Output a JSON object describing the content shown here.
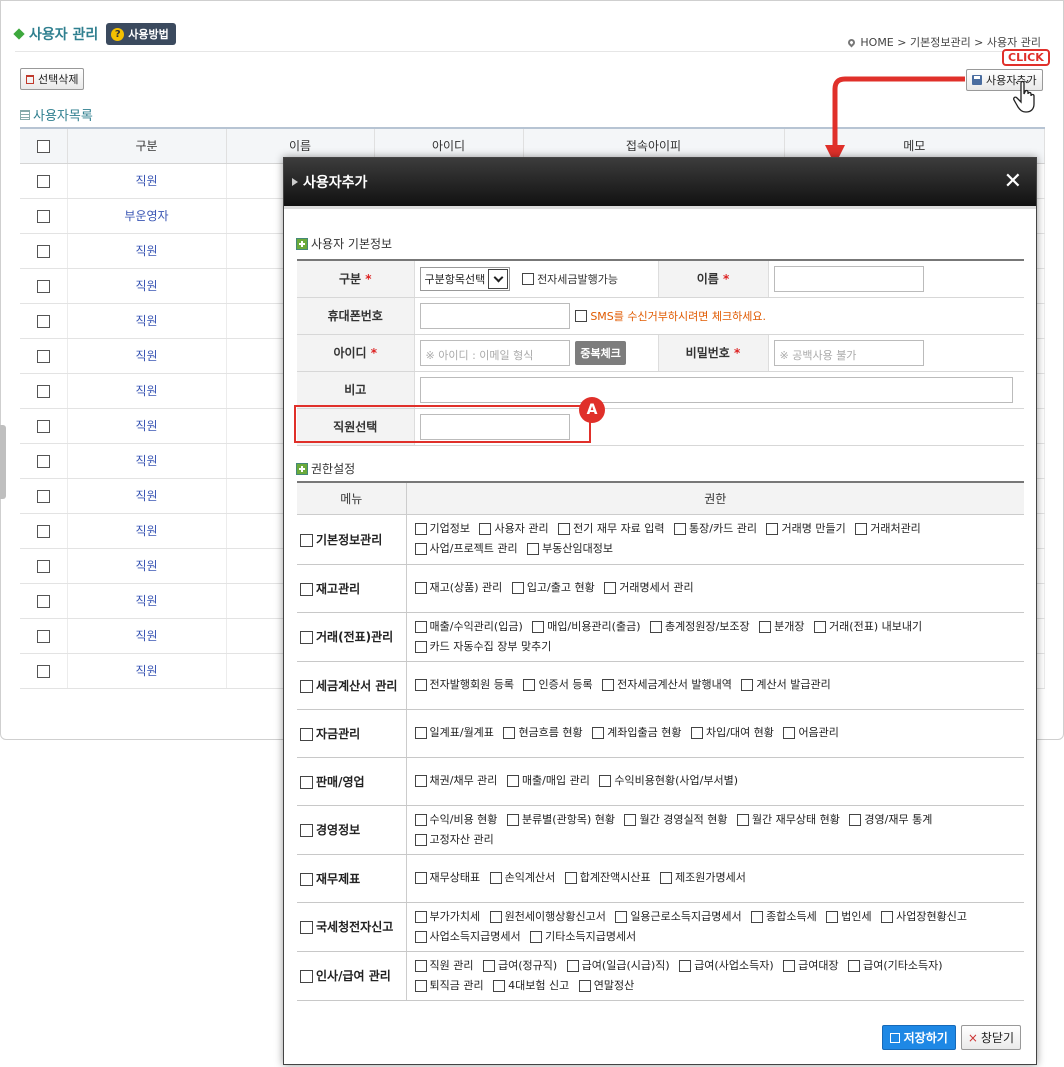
{
  "page": {
    "title": "사용자 관리",
    "help_label": "사용방법",
    "help_icon": "question-icon",
    "breadcrumb": "HOME > 기본정보관리 > 사용자 관리",
    "delete_label": "선택삭제",
    "add_label": "사용자추가",
    "click_label": "CLICK",
    "list_title": "사용자목록",
    "accent_color": "#e0302a"
  },
  "list": {
    "columns": [
      "구분",
      "이름",
      "아이디",
      "접속아이피",
      "메모"
    ],
    "rows": [
      "직원",
      "부운영자",
      "직원",
      "직원",
      "직원",
      "직원",
      "직원",
      "직원",
      "직원",
      "직원",
      "직원",
      "직원",
      "직원",
      "직원",
      "직원"
    ]
  },
  "modal": {
    "title": "사용자추가",
    "basic_section": "사용자 기본정보",
    "fields": {
      "category_label": "구분",
      "category_value": "구분항목선택",
      "etax_label": "전자세금발행가능",
      "name_label": "이름",
      "phone_label": "휴대폰번호",
      "sms_note": "SMS를 수신거부하시려면 체크하세요.",
      "id_label": "아이디",
      "id_placeholder": "※ 아이디 : 이메일 형식",
      "dup_check": "중복체크",
      "pw_label": "비밀번호",
      "pw_placeholder": "※ 공백사용 불가",
      "note_label": "비고",
      "employee_label": "직원선택",
      "required_mark": "*"
    },
    "badge_a": "A",
    "perm_section": "권한설정",
    "perm_header_menu": "메뉴",
    "perm_header_perm": "권한",
    "permissions": [
      {
        "menu": "기본정보관리",
        "items": [
          "기업정보",
          "사용자 관리",
          "전기 재무 자료 입력",
          "통장/카드 관리",
          "거래명 만들기",
          "거래처관리",
          "사업/프로젝트 관리",
          "부동산임대정보"
        ]
      },
      {
        "menu": "재고관리",
        "items": [
          "재고(상품) 관리",
          "입고/출고 현황",
          "거래명세서 관리"
        ]
      },
      {
        "menu": "거래(전표)관리",
        "items": [
          "매출/수익관리(입금)",
          "매입/비용관리(출금)",
          "총계정원장/보조장",
          "분개장",
          "거래(전표) 내보내기",
          "카드 자동수집 장부 맞추기"
        ]
      },
      {
        "menu": "세금계산서 관리",
        "items": [
          "전자발행회원 등록",
          "인증서 등록",
          "전자세금계산서 발행내역",
          "계산서 발급관리"
        ]
      },
      {
        "menu": "자금관리",
        "items": [
          "일계표/월계표",
          "현금흐름 현황",
          "계좌입출금 현황",
          "차입/대여 현황",
          "어음관리"
        ]
      },
      {
        "menu": "판매/영업",
        "items": [
          "채권/채무 관리",
          "매출/매입 관리",
          "수익비용현황(사업/부서별)"
        ]
      },
      {
        "menu": "경영정보",
        "items": [
          "수익/비용 현황",
          "분류별(관항목) 현황",
          "월간 경영실적 현황",
          "월간 재무상태 현황",
          "경영/재무 통계",
          "고정자산 관리"
        ]
      },
      {
        "menu": "재무제표",
        "items": [
          "재무상태표",
          "손익계산서",
          "합계잔액시산표",
          "제조원가명세서"
        ]
      },
      {
        "menu": "국세청전자신고",
        "items": [
          "부가가치세",
          "원천세이행상황신고서",
          "일용근로소득지급명세서",
          "종합소득세",
          "법인세",
          "사업장현황신고",
          "사업소득지급명세서",
          "기타소득지급명세서"
        ]
      },
      {
        "menu": "인사/급여 관리",
        "items": [
          "직원 관리",
          "급여(정규직)",
          "급여(일급(시급)직)",
          "급여(사업소득자)",
          "급여대장",
          "급여(기타소득자)",
          "퇴직금 관리",
          "4대보험 신고",
          "연말정산"
        ]
      }
    ],
    "save_label": "저장하기",
    "close_label": "창닫기",
    "close_icon": "close-x-icon"
  }
}
